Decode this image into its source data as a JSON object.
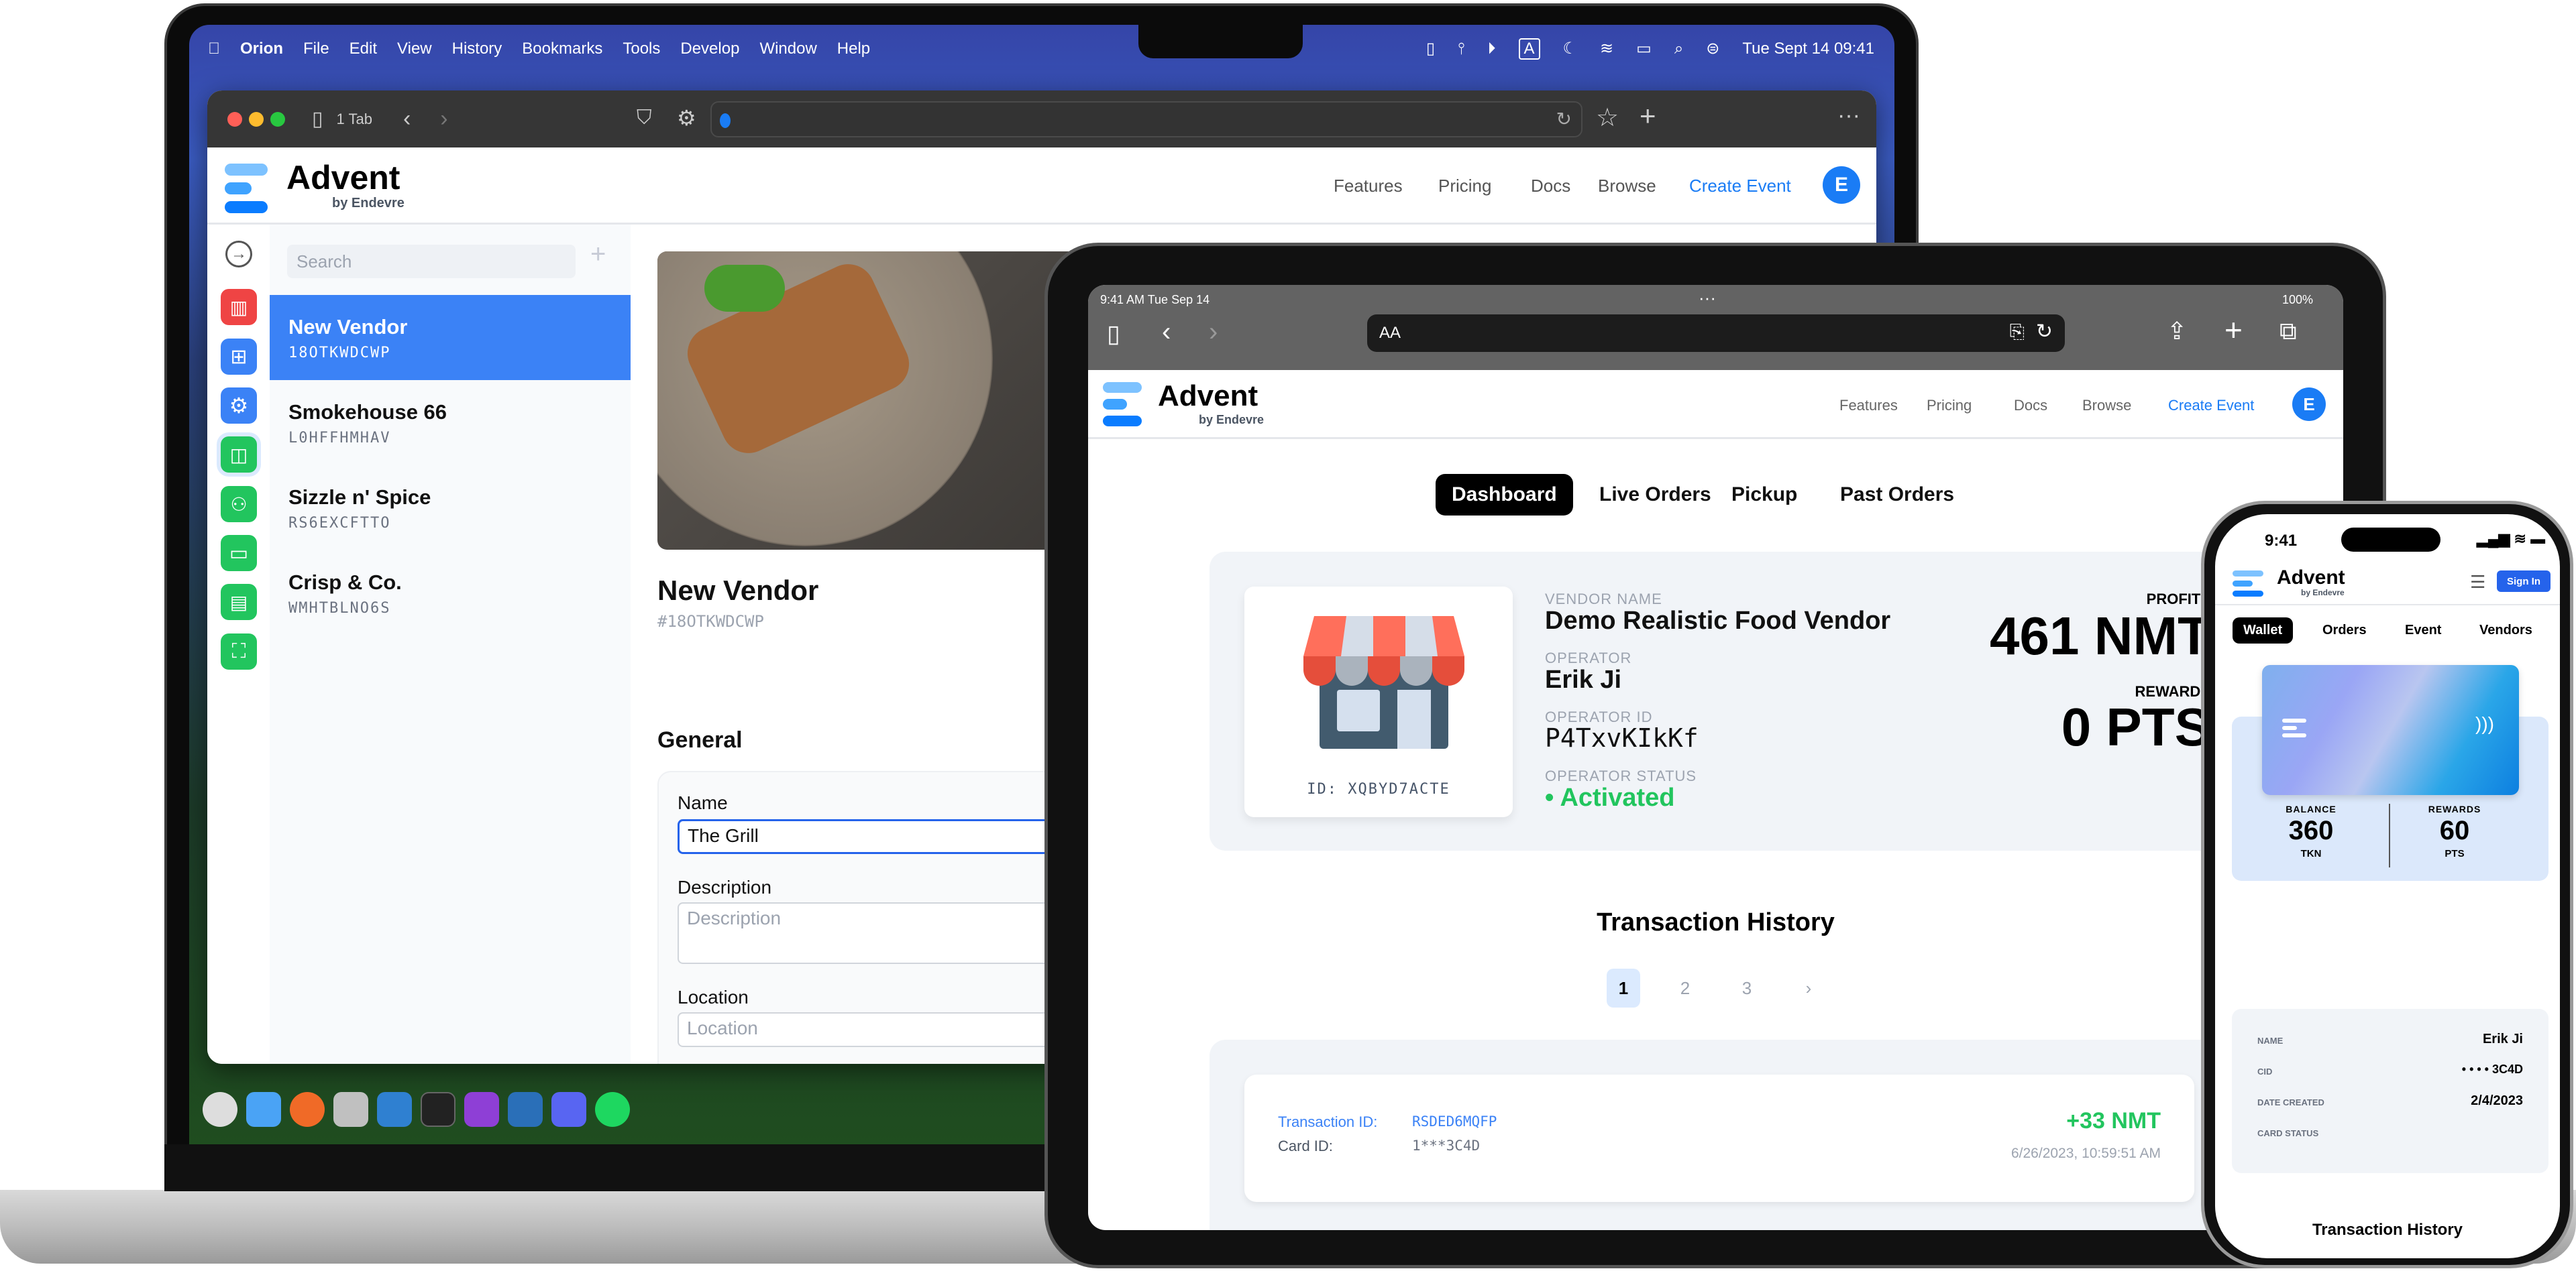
{
  "macos": {
    "menubar": {
      "app": "Orion",
      "items": [
        "File",
        "Edit",
        "View",
        "History",
        "Bookmarks",
        "Tools",
        "Develop",
        "Window",
        "Help"
      ],
      "clock": "Tue Sept 14  09:41"
    },
    "browser": {
      "tab_count": "1 Tab",
      "url": ""
    },
    "site": {
      "logo": "Advent",
      "logo_sub": "by Endevre",
      "nav": [
        "Features",
        "Pricing",
        "Docs",
        "Browse"
      ],
      "cta": "Create Event",
      "avatar": "E",
      "accent": "#1a7cf5"
    },
    "sidebar_icons": [
      "arrow-right-circle-icon",
      "chart-icon",
      "layout-icon",
      "gear-icon",
      "shopping-bag-icon",
      "users-icon",
      "credit-card-icon",
      "document-icon",
      "scan-icon"
    ],
    "search_placeholder": "Search",
    "vendors": [
      {
        "name": "New Vendor",
        "code": "18OTKWDCWP",
        "selected": true
      },
      {
        "name": "Smokehouse 66",
        "code": "L0HFFHMHAV"
      },
      {
        "name": "Sizzle n' Spice",
        "code": "RS6EXCFTTO"
      },
      {
        "name": "Crisp & Co.",
        "code": "WMHTBLNO6S"
      }
    ],
    "detail": {
      "title": "New Vendor",
      "code": "#18OTKWDCWP",
      "section": "General",
      "fields": {
        "name_label": "Name",
        "name_value": "The Grill",
        "desc_label": "Description",
        "desc_placeholder": "Description",
        "loc_label": "Location",
        "loc_placeholder": "Location"
      }
    }
  },
  "ipad": {
    "status": {
      "time": "9:41 AM  Tue Sep 14",
      "battery": "100%"
    },
    "address": "AA",
    "site": {
      "logo": "Advent",
      "logo_sub": "by Endevre",
      "nav": [
        "Features",
        "Pricing",
        "Docs",
        "Browse"
      ],
      "cta": "Create Event",
      "avatar": "E"
    },
    "tabs": [
      "Dashboard",
      "Live Orders",
      "Pickup",
      "Past Orders"
    ],
    "vendor": {
      "store_id": "ID: XQBYD7ACTE",
      "vendor_name_label": "VENDOR NAME",
      "vendor_name": "Demo Realistic Food Vendor",
      "operator_label": "OPERATOR",
      "operator": "Erik Ji",
      "operator_id_label": "OPERATOR ID",
      "operator_id": "P4TxvKIkKf",
      "status_label": "OPERATOR STATUS",
      "status": "• Activated",
      "profits_label": "PROFITS",
      "profits": "461 NMT",
      "rewards_label": "REWARDS",
      "rewards": "0 PTS",
      "status_color": "#22c55e"
    },
    "transactions": {
      "title": "Transaction History",
      "pages": [
        "1",
        "2",
        "3",
        "›"
      ],
      "current_page": "1",
      "items": [
        {
          "tx_label": "Transaction ID:",
          "tx_id": "RSDED6MQFP",
          "card_label": "Card ID:",
          "card_id": "1***3C4D",
          "amount": "+33 NMT",
          "date": "6/26/2023, 10:59:51 AM"
        }
      ]
    }
  },
  "iphone": {
    "status": {
      "time": "9:41"
    },
    "site": {
      "logo": "Advent",
      "logo_sub": "by Endevre",
      "signin": "Sign In"
    },
    "tabs": [
      "Wallet",
      "Orders",
      "Event",
      "Vendors"
    ],
    "wallet": {
      "balance_label": "BALANCE",
      "balance": "360",
      "balance_unit": "TKN",
      "rewards_label": "REWARDS",
      "rewards": "60",
      "rewards_unit": "PTS"
    },
    "info": {
      "name_label": "NAME",
      "name": "Erik Ji",
      "cid_label": "CID",
      "cid": "• • • •  3C4D",
      "date_label": "DATE CREATED",
      "date": "2/4/2023",
      "status_label": "CARD STATUS"
    },
    "tx_title": "Transaction History"
  }
}
